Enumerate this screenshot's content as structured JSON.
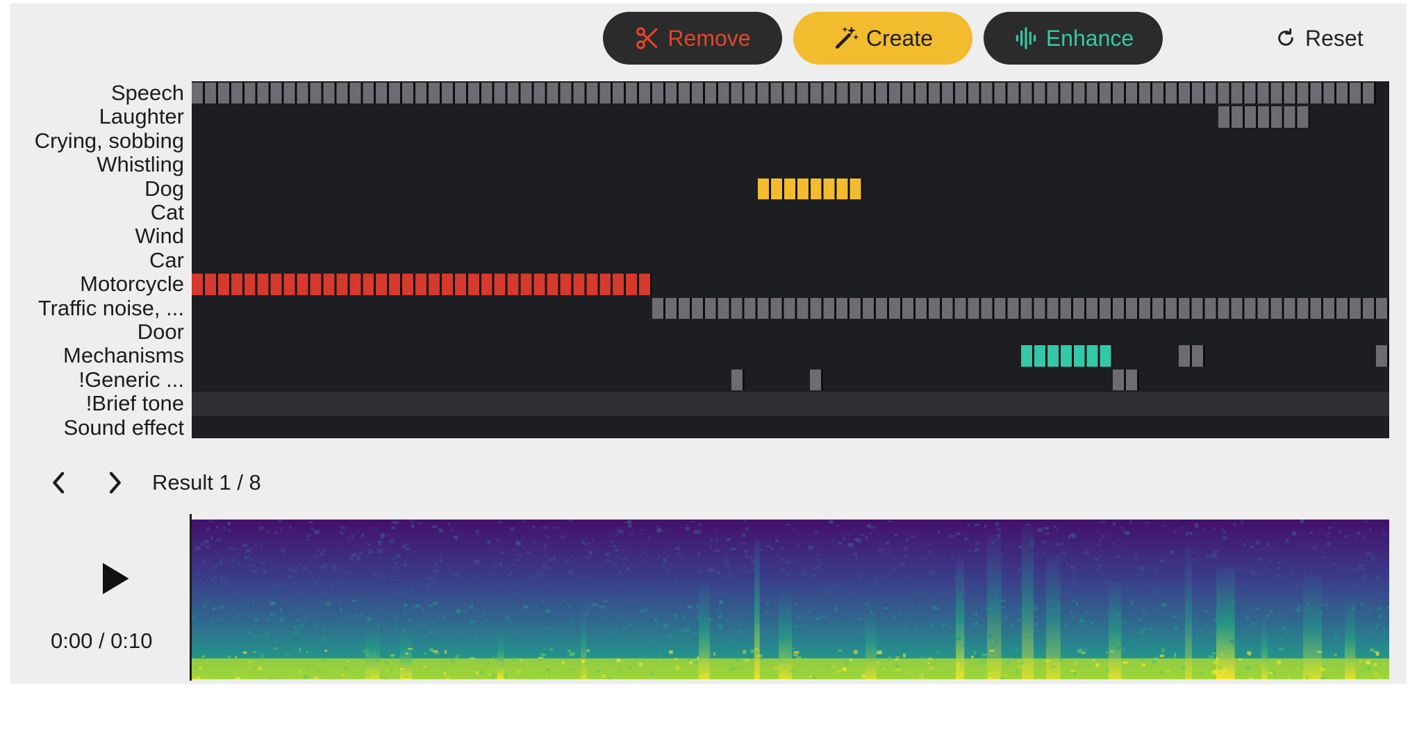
{
  "toolbar": {
    "remove_label": "Remove",
    "create_label": "Create",
    "enhance_label": "Enhance",
    "reset_label": "Reset"
  },
  "timeline": {
    "rows": [
      {
        "label": "Speech"
      },
      {
        "label": "Laughter"
      },
      {
        "label": "Crying, sobbing"
      },
      {
        "label": "Whistling"
      },
      {
        "label": "Dog"
      },
      {
        "label": "Cat"
      },
      {
        "label": "Wind"
      },
      {
        "label": "Car"
      },
      {
        "label": "Motorcycle"
      },
      {
        "label": "Traffic noise, ..."
      },
      {
        "label": "Door"
      },
      {
        "label": "Mechanisms"
      },
      {
        "label": "!Generic ..."
      },
      {
        "label": "!Brief tone"
      },
      {
        "label": "Sound effect"
      }
    ],
    "highlighted_row": 13,
    "total_frames": 91,
    "segments": [
      {
        "row": 0,
        "start": 0,
        "end": 90,
        "color": "#6e6c72"
      },
      {
        "row": 1,
        "start": 78,
        "end": 85,
        "color": "#6e6c72"
      },
      {
        "row": 4,
        "start": 43,
        "end": 51,
        "color": "#f2bc2e"
      },
      {
        "row": 8,
        "start": 0,
        "end": 35,
        "color": "#d63a2c"
      },
      {
        "row": 9,
        "start": 35,
        "end": 91,
        "color": "#6e6c72"
      },
      {
        "row": 11,
        "start": 63,
        "end": 70,
        "color": "#33c9a8"
      },
      {
        "row": 11,
        "start": 75,
        "end": 77,
        "color": "#6e6c72"
      },
      {
        "row": 11,
        "start": 90,
        "end": 91,
        "color": "#6e6c72"
      },
      {
        "row": 12,
        "start": 41,
        "end": 42,
        "color": "#6e6c72"
      },
      {
        "row": 12,
        "start": 47,
        "end": 48,
        "color": "#6e6c72"
      },
      {
        "row": 12,
        "start": 70,
        "end": 72,
        "color": "#6e6c72"
      }
    ]
  },
  "results": {
    "label": "Result 1 / 8"
  },
  "player": {
    "time": "0:00 / 0:10"
  },
  "colors": {
    "remove": "#e2452e",
    "create": "#f2bc2e",
    "enhance": "#33c9a8",
    "grid_bg": "#1c1e21"
  }
}
